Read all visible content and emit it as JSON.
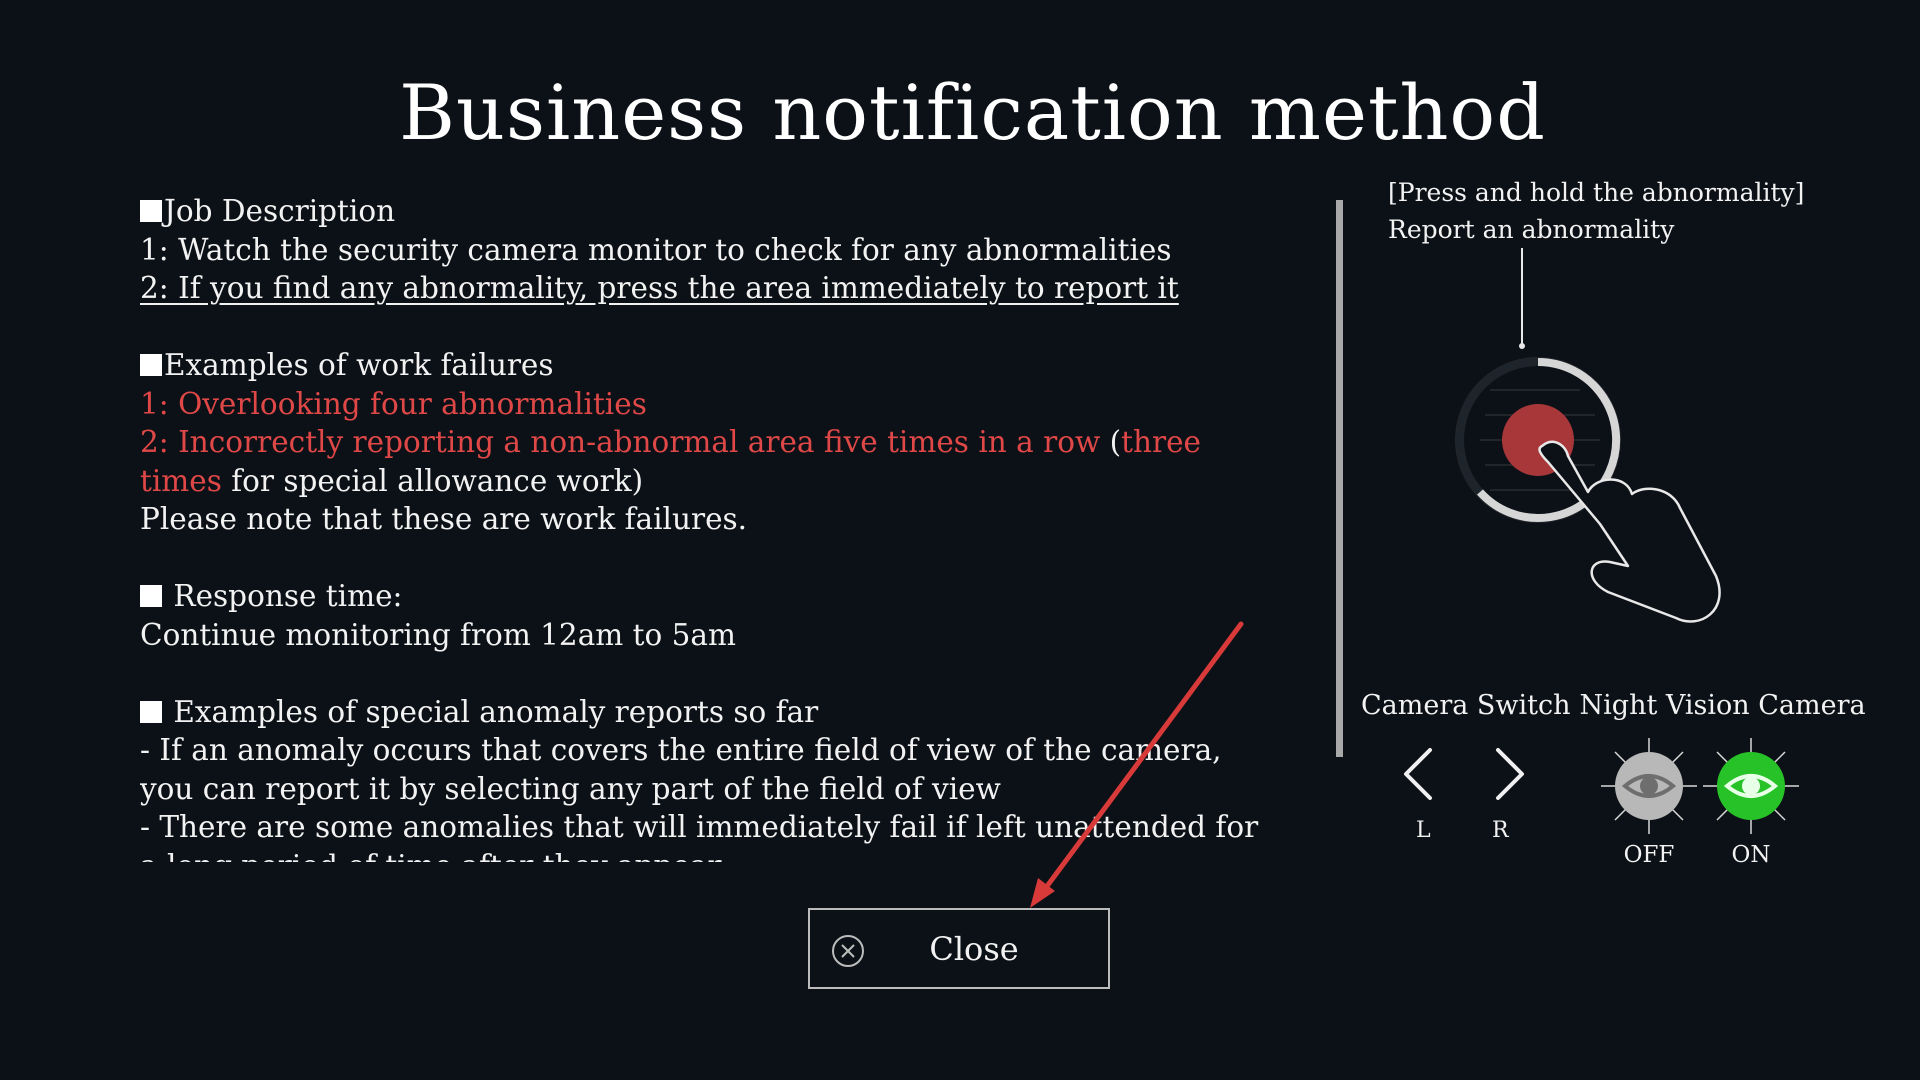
{
  "title": "Business notification method",
  "content": {
    "job_heading": "Job Description",
    "job_1": "1: Watch the security camera monitor to check for any abnormalities",
    "job_2": "2: If you find any abnormality, press the area immediately to report it",
    "fail_heading": "Examples of work failures",
    "fail_1": "1: Overlooking four abnormalities",
    "fail_2_red": "2: Incorrectly reporting a non-abnormal area five times in a row",
    "fail_2_open": " (",
    "fail_2_three": "three",
    "fail_2_times": "times",
    "fail_2_rest": " for special allowance work)",
    "fail_note": "Please note that these are work failures.",
    "response_heading": " Response time:",
    "response_text": "Continue monitoring from 12am to 5am",
    "special_heading": " Examples of special anomaly reports so far",
    "special_1a": "- If an anomaly occurs that covers the entire field of view of the camera,",
    "special_1b": "you can report it by selecting any part of the field of view",
    "special_2a": "- There are some anomalies that will immediately fail if left unattended for",
    "special_2b": "a long period of time after they appear"
  },
  "instruction": {
    "line1": "[Press and hold the abnormality]",
    "line2": "Report an abnormality"
  },
  "camera": {
    "switch_label": "Camera Switch",
    "night_label": "Night Vision Camera",
    "left_label": "L",
    "right_label": "R",
    "off_label": "OFF",
    "on_label": "ON"
  },
  "close_label": "Close",
  "colors": {
    "background": "#0c1117",
    "warning_red": "#e04848",
    "night_on": "#27c227",
    "night_off": "#b8b8b8",
    "record_dot": "#a8373a",
    "annotation_arrow": "#d83a3a"
  },
  "icons": {
    "left": "chevron-left-icon",
    "right": "chevron-right-icon",
    "eye": "eye-icon",
    "close": "close-circle-icon",
    "hand": "pointing-hand-icon"
  }
}
